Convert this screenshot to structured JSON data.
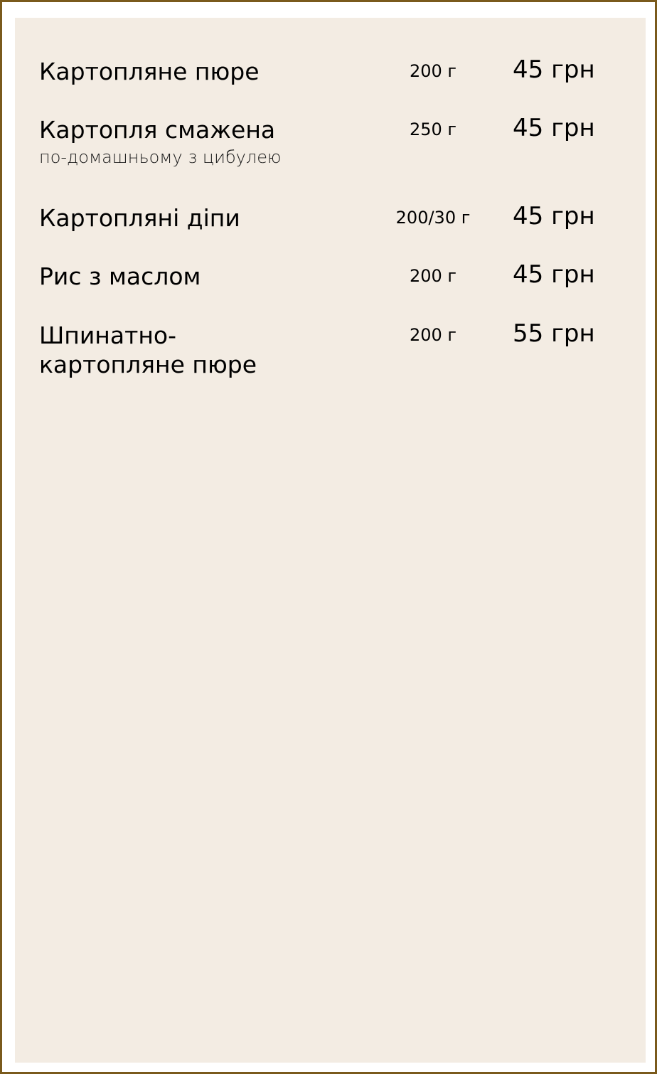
{
  "menu": {
    "items": [
      {
        "name": "Картопляне пюре",
        "description": "",
        "weight": "200 г",
        "price": "45 грн"
      },
      {
        "name": "Картопля смажена",
        "description": "по-домашньому з цибулею",
        "weight": "250 г",
        "price": "45 грн"
      },
      {
        "name": "Картопляні діпи",
        "description": "",
        "weight": "200/30 г",
        "price": "45 грн"
      },
      {
        "name": "Рис з маслом",
        "description": "",
        "weight": "200 г",
        "price": "45 грн"
      },
      {
        "name": "Шпинатно-\nкартопляне пюре",
        "description": "",
        "weight": "200 г",
        "price": "55 грн"
      }
    ]
  },
  "colors": {
    "border": "#7a5a1c",
    "panel_background": "#f3ece3",
    "text": "#000000"
  }
}
